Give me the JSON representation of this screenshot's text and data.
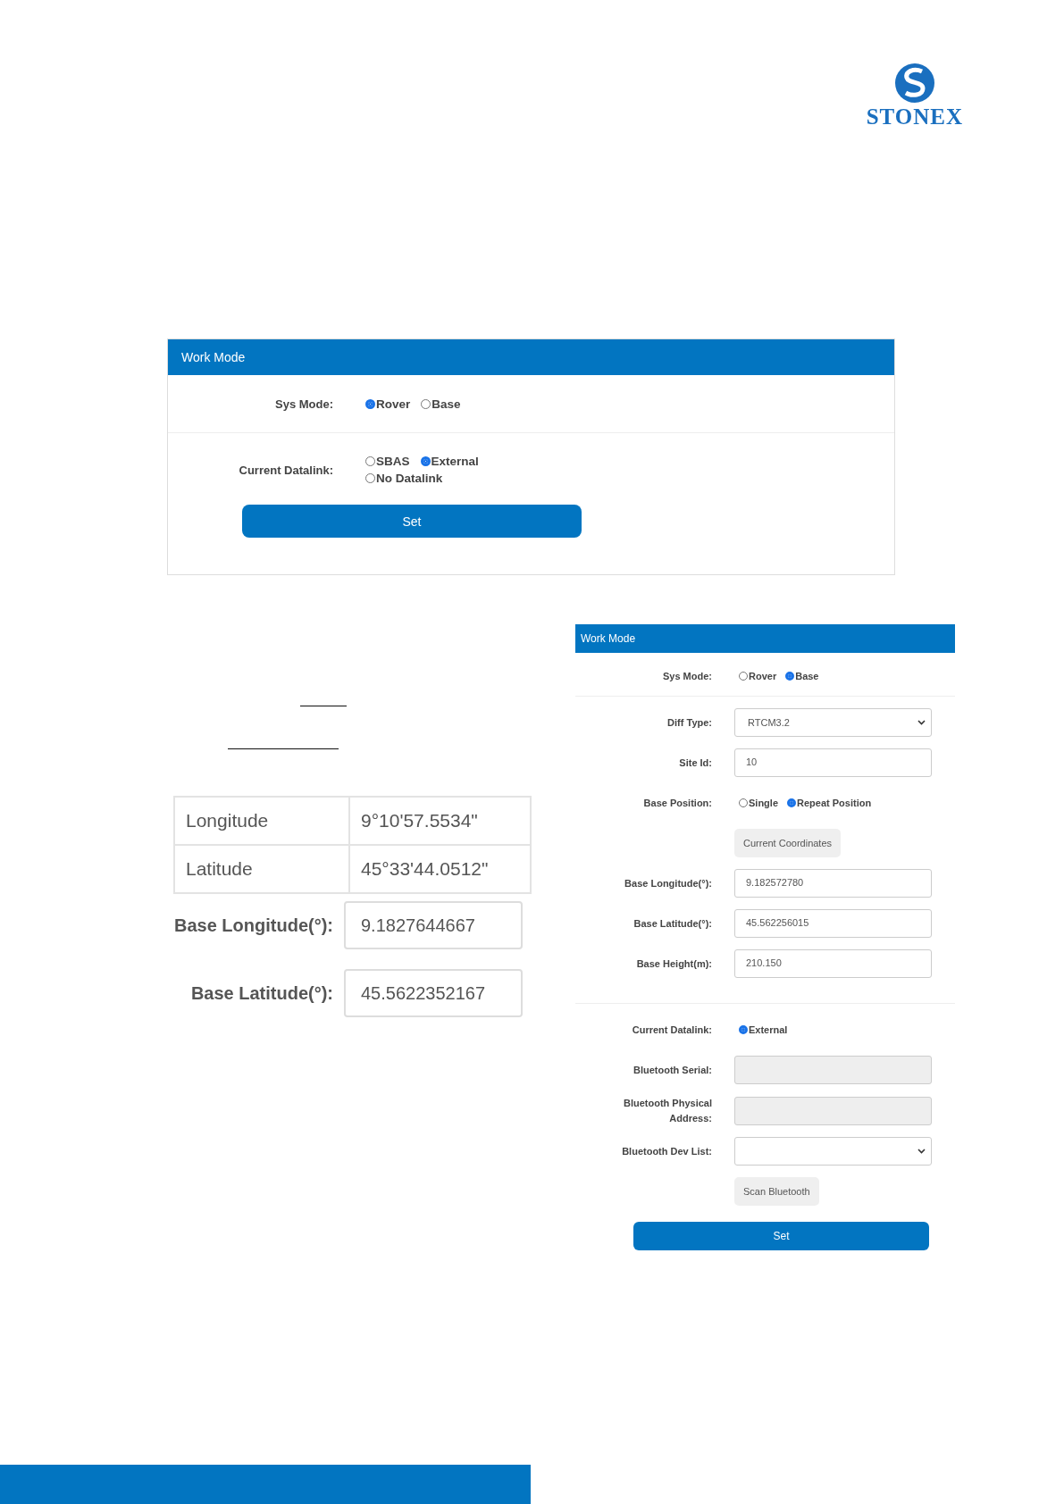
{
  "logo": {
    "text": "STONEX"
  },
  "rover_panel": {
    "title": "Work Mode",
    "sys_mode": {
      "label": "Sys Mode:",
      "options": [
        {
          "label": "Rover",
          "selected": true
        },
        {
          "label": "Base",
          "selected": false
        }
      ]
    },
    "datalink": {
      "label": "Current Datalink:",
      "options": [
        {
          "label": "SBAS",
          "selected": false
        },
        {
          "label": "External",
          "selected": true
        },
        {
          "label": "No Datalink",
          "selected": false
        }
      ]
    },
    "button": "Set"
  },
  "coords_table": {
    "rows": [
      {
        "name": "Longitude",
        "value": "9°10'57.5534\""
      },
      {
        "name": "Latitude",
        "value": "45°33'44.0512\""
      }
    ]
  },
  "base_fields": [
    {
      "label": "Base Longitude(°):",
      "value": "9.1827644667"
    },
    {
      "label": "Base Latitude(°):",
      "value": "45.5622352167"
    }
  ],
  "base_panel": {
    "title": "Work Mode",
    "sys_mode": {
      "label": "Sys Mode:",
      "options": [
        {
          "label": "Rover",
          "selected": false
        },
        {
          "label": "Base",
          "selected": true
        }
      ]
    },
    "rows": [
      {
        "kind": "select",
        "label": "Diff Type:",
        "value": "RTCM3.2"
      },
      {
        "kind": "input",
        "label": "Site Id:",
        "value": "10"
      },
      {
        "kind": "radio",
        "label": "Base Position:",
        "options": [
          {
            "label": "Single",
            "selected": false
          },
          {
            "label": "Repeat Position",
            "selected": true
          }
        ]
      },
      {
        "kind": "button",
        "label": "Current Coordinates"
      },
      {
        "kind": "input",
        "label": "Base Longitude(°):",
        "value": "9.182572780"
      },
      {
        "kind": "input",
        "label": "Base Latitude(°):",
        "value": "45.562256015"
      },
      {
        "kind": "input",
        "label": "Base Height(m):",
        "value": "210.150"
      },
      {
        "kind": "divider"
      },
      {
        "kind": "radio",
        "label": "Current Datalink:",
        "options": [
          {
            "label": "External",
            "selected": true
          }
        ]
      },
      {
        "kind": "input",
        "label": "Bluetooth Serial:",
        "disabled": true
      },
      {
        "kind": "input",
        "label": "Bluetooth Physical Address:",
        "disabled": true
      },
      {
        "kind": "select",
        "label": "Bluetooth Dev List:"
      },
      {
        "kind": "button",
        "label": "Scan Bluetooth"
      }
    ],
    "button": "Set"
  }
}
